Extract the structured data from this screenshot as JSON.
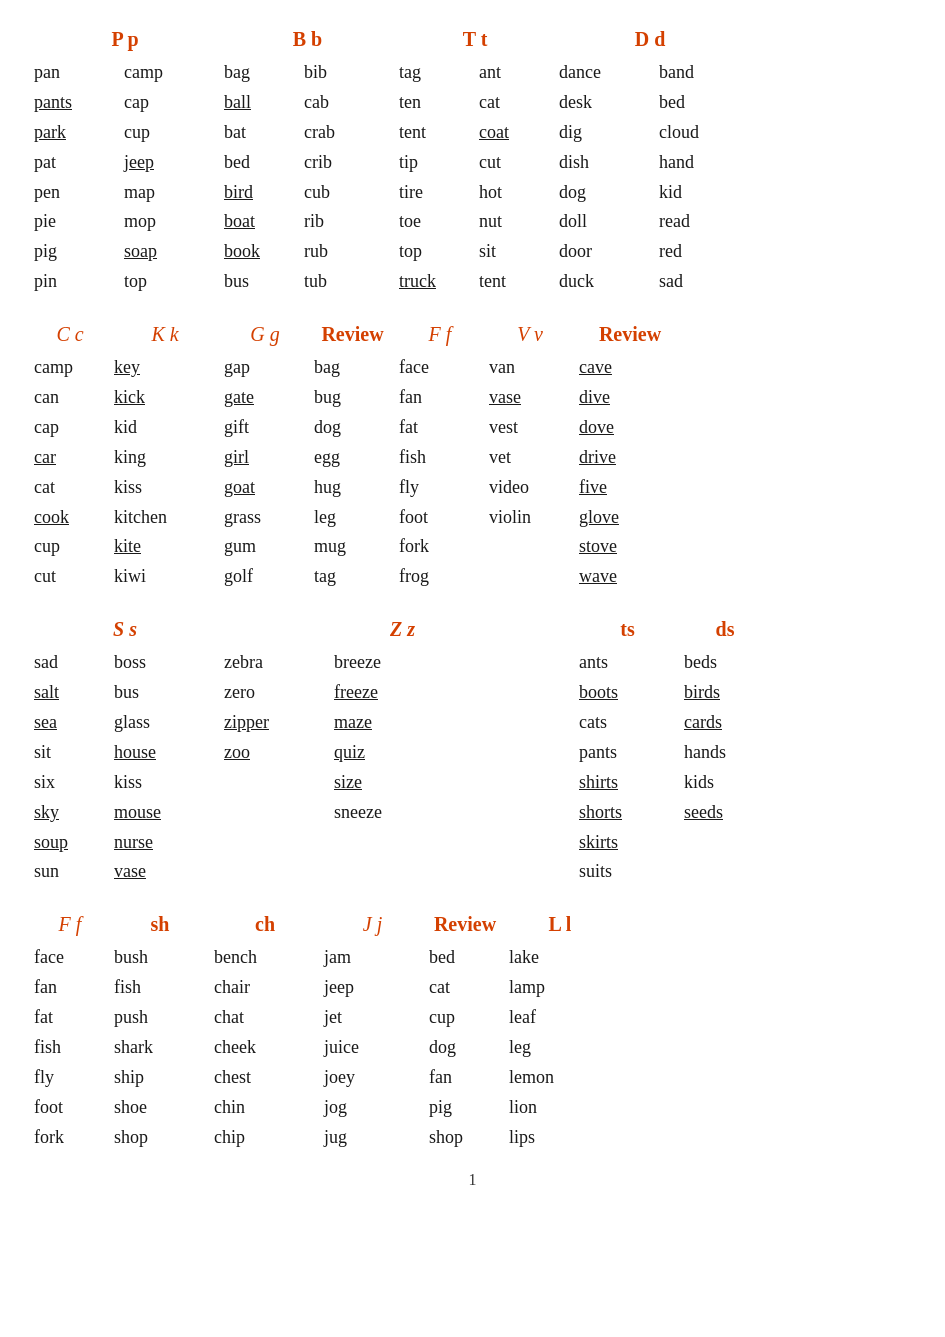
{
  "sections": {
    "s1": {
      "headers": [
        "P p",
        "B b",
        "T t",
        "D d"
      ],
      "cols": [
        [
          "pan",
          "pants",
          "park",
          "pat",
          "pen",
          "pie",
          "pig",
          "pin"
        ],
        [
          "camp",
          "cap",
          "cup",
          "map",
          "mop",
          "soap",
          "top",
          ""
        ],
        [
          "bag",
          "ball",
          "bat",
          "bed",
          "bird",
          "boat",
          "book",
          "bus"
        ],
        [
          "bib",
          "cab",
          "crab",
          "crib",
          "cub",
          "rib",
          "rub",
          "tub"
        ],
        [
          "tag",
          "ten",
          "tent",
          "tip",
          "tire",
          "toe",
          "top",
          "truck"
        ],
        [
          "ant",
          "cat",
          "coat",
          "cut",
          "hot",
          "nut",
          "sit",
          "tent"
        ],
        [
          "dance",
          "desk",
          "dig",
          "dish",
          "dog",
          "doll",
          "door",
          "duck"
        ],
        [
          "band",
          "bed",
          "cloud",
          "hand",
          "kid",
          "read",
          "red",
          "sad"
        ]
      ],
      "underline": {
        "1-1": true,
        "1-2": true,
        "2-1": true,
        "2-4": true,
        "3-3": true,
        "3-5": true
      }
    },
    "s2": {
      "headers": [
        "C c",
        "K k",
        "G g",
        "Review",
        "F f",
        "V v",
        "Review"
      ],
      "italic": [
        0,
        1,
        2,
        4,
        5
      ],
      "cols": [
        [
          "camp",
          "can",
          "cap",
          "car",
          "cat",
          "cook",
          "cup",
          "cut"
        ],
        [
          "key",
          "kick",
          "kid",
          "king",
          "kiss",
          "kitchen",
          "kite",
          "kiwi"
        ],
        [
          "gap",
          "gate",
          "gift",
          "girl",
          "goat",
          "grass",
          "gum",
          "golf"
        ],
        [
          "bag",
          "bug",
          "dog",
          "egg",
          "hug",
          "leg",
          "mug",
          "tag"
        ],
        [
          "face",
          "fan",
          "fat",
          "fish",
          "fly",
          "foot",
          "fork",
          "frog"
        ],
        [
          "van",
          "vase",
          "vest",
          "vet",
          "video",
          "violin",
          "",
          ""
        ],
        [
          "cave",
          "dive",
          "dove",
          "drive",
          "five",
          "glove",
          "stove",
          "wave"
        ]
      ]
    },
    "s3": {
      "headers": [
        "S s",
        "Z z",
        "ts",
        "ds"
      ],
      "cols_left": [
        [
          "sad",
          "salt",
          "sea",
          "sit",
          "six",
          "sky",
          "soup",
          "sun"
        ],
        [
          "boss",
          "bus",
          "glass",
          "house",
          "kiss",
          "mouse",
          "nurse",
          "vase"
        ]
      ],
      "cols_mid": [
        [
          "zebra",
          "zero",
          "zipper",
          "zoo",
          "",
          "",
          "",
          ""
        ]
      ],
      "cols_breeze": [
        [
          "breeze",
          "freeze",
          "maze",
          "quiz",
          "size",
          "sneeze",
          "",
          ""
        ]
      ],
      "cols_right": [
        [
          "ants",
          "boots",
          "cats",
          "pants",
          "shirts",
          "shorts",
          "skirts",
          "suits"
        ],
        [
          "beds",
          "birds",
          "cards",
          "hands",
          "kids",
          "seeds",
          "",
          ""
        ]
      ]
    },
    "s4": {
      "headers": [
        "F f",
        "sh",
        "ch",
        "J j",
        "Review",
        "L l"
      ],
      "italic_ff": true,
      "cols": [
        [
          "face",
          "fan",
          "fat",
          "fish",
          "fly",
          "foot",
          "fork"
        ],
        [
          "bush",
          "fish",
          "push",
          "shark",
          "ship",
          "shoe",
          "shop"
        ],
        [
          "bench",
          "chair",
          "chat",
          "cheek",
          "chest",
          "chin",
          "chip"
        ],
        [
          "jam",
          "jeep",
          "jet",
          "juice",
          "joey",
          "jog",
          "jug"
        ],
        [
          "bed",
          "cat",
          "cup",
          "dog",
          "fan",
          "pig",
          "shop"
        ],
        [
          "lake",
          "lamp",
          "leaf",
          "leg",
          "lemon",
          "lion",
          "lips"
        ]
      ]
    }
  },
  "page_number": "1"
}
